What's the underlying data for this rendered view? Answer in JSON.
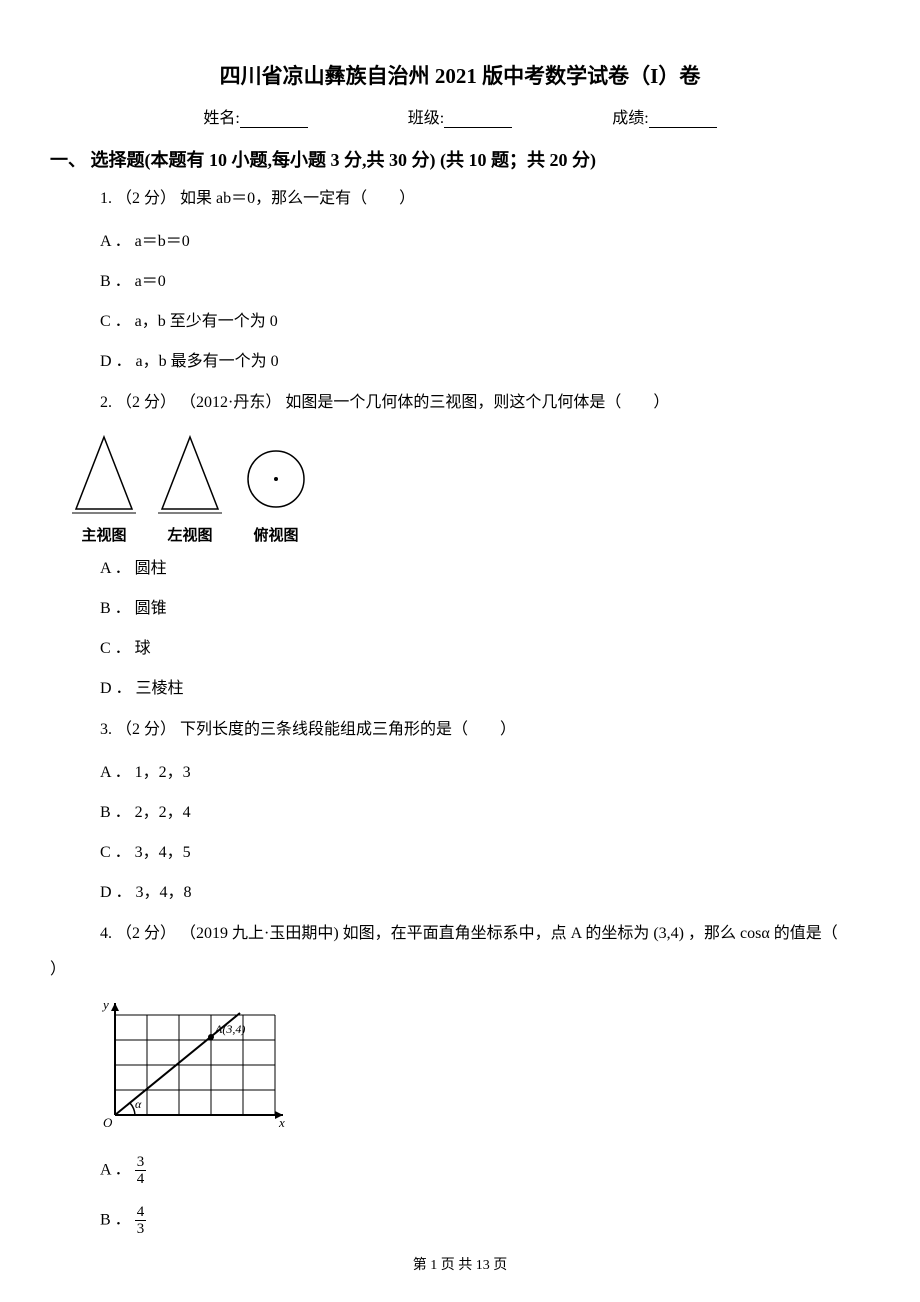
{
  "title": "四川省凉山彝族自治州 2021 版中考数学试卷（I）卷",
  "info": {
    "name_label": "姓名:",
    "class_label": "班级:",
    "score_label": "成绩:"
  },
  "section": "一、 选择题(本题有 10 小题,每小题 3 分,共 30 分) (共 10 题；共 20 分)",
  "q1": {
    "stem": "1.  （2 分） 如果 ab＝0，那么一定有（　　）",
    "a": "A ． a＝b＝0",
    "b": "B ． a＝0",
    "c": "C ． a，b 至少有一个为 0",
    "d": "D ． a，b 最多有一个为 0"
  },
  "q2": {
    "stem": "2.  （2 分） （2012·丹东） 如图是一个几何体的三视图，则这个几何体是（　　）",
    "views": {
      "front": "主视图",
      "side": "左视图",
      "top": "俯视图"
    },
    "a": "A ． 圆柱",
    "b": "B ． 圆锥",
    "c": "C ． 球",
    "d": "D ． 三棱柱"
  },
  "q3": {
    "stem": "3.  （2 分） 下列长度的三条线段能组成三角形的是（　　）",
    "a": "A ． 1，2，3",
    "b": "B ． 2，2，4",
    "c": "C ． 3，4，5",
    "d": "D ． 3，4，8"
  },
  "q4": {
    "stem_pre": "4.  （2 分） （2019 九上·玉田期中) 如图，在平面直角坐标系中，点 A 的坐标为",
    "coord": "(3,4)",
    "stem_mid": "，那么 cosα 的值是（",
    "stem_close": "）",
    "a_prefix": "A ．",
    "a_num": "3",
    "a_den": "4",
    "b_prefix": "B ．",
    "b_num": "4",
    "b_den": "3",
    "figure_label_A": "A(3,4)",
    "figure_label_alpha": "α",
    "figure_label_O": "O",
    "figure_label_y": "y",
    "figure_label_x": "x"
  },
  "footer": "第 1 页 共 13 页"
}
